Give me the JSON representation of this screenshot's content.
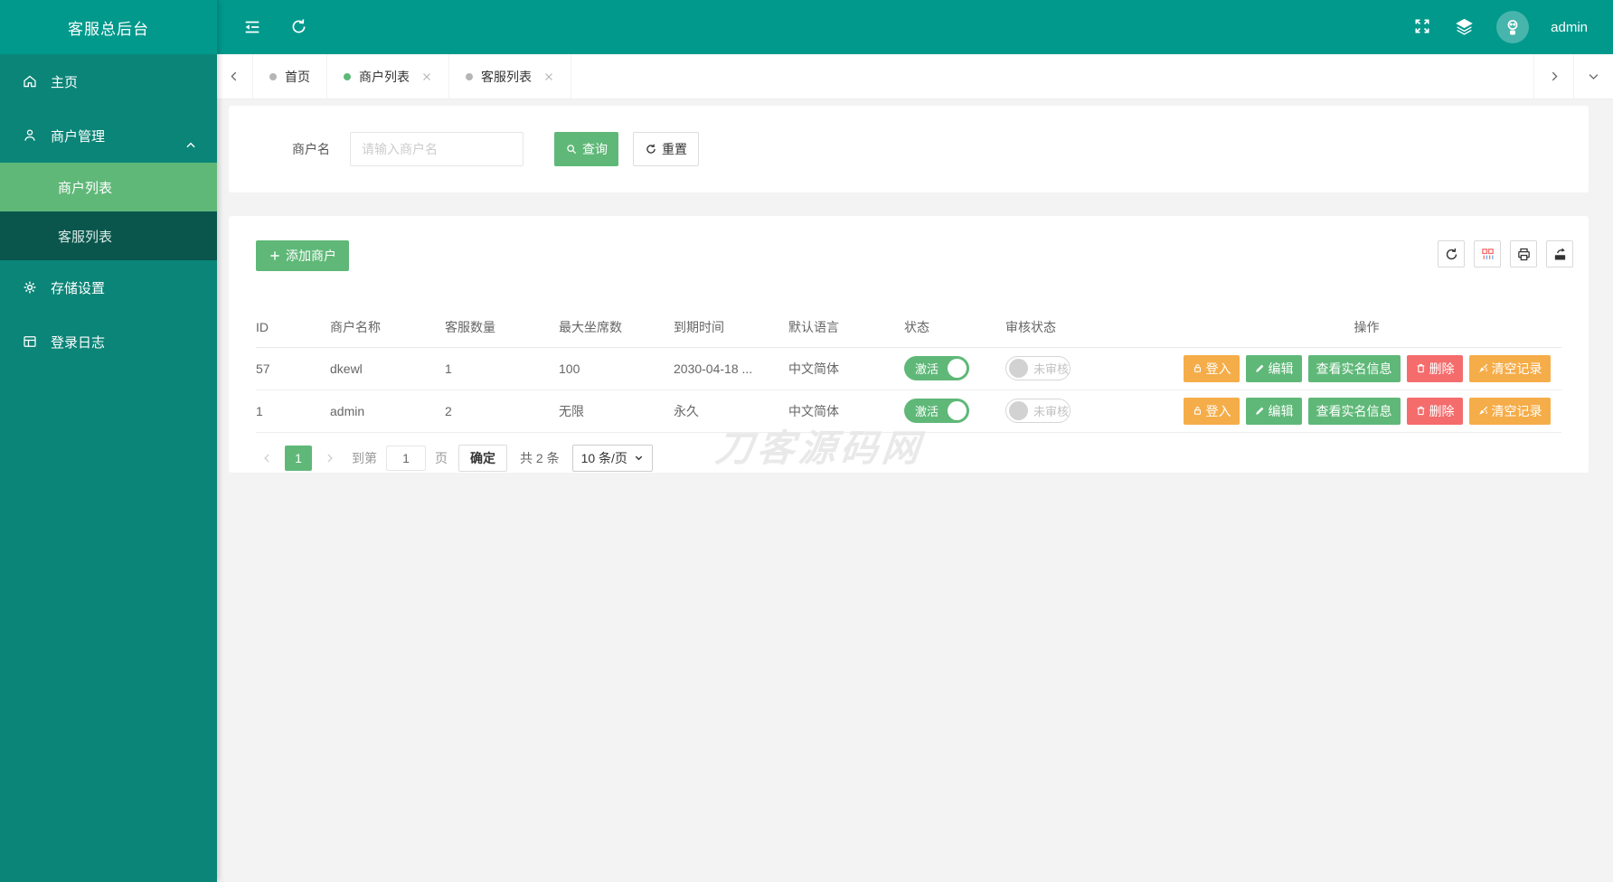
{
  "colors": {
    "teal_header": "#00998C",
    "teal_sidebar": "#0B8578",
    "accent_green": "#5FB878",
    "orange": "#F5AD49",
    "red": "#F56C6C",
    "submenu_dark": "#0A564D"
  },
  "header": {
    "username": "admin"
  },
  "sidebar": {
    "title": "客服总后台",
    "home": "主页",
    "merchant_mgmt": "商户管理",
    "merchant_list": "商户列表",
    "service_list": "客服列表",
    "storage": "存储设置",
    "login_log": "登录日志"
  },
  "tabs": {
    "home": "首页",
    "merchant_list": "商户列表",
    "service_list": "客服列表"
  },
  "search": {
    "label": "商户名",
    "placeholder": "请输入商户名",
    "query": "查询",
    "reset": "重置"
  },
  "toolbar": {
    "add": "添加商户"
  },
  "table": {
    "headers": [
      "ID",
      "商户名称",
      "客服数量",
      "最大坐席数",
      "到期时间",
      "默认语言",
      "状态",
      "审核状态",
      "操作"
    ],
    "rows": [
      {
        "id": "57",
        "name": "dkewl",
        "agents": "1",
        "seats": "100",
        "expire": "2030-04-18 ...",
        "lang": "中文简体",
        "status": "激活",
        "audit": "未审核"
      },
      {
        "id": "1",
        "name": "admin",
        "agents": "2",
        "seats": "无限",
        "expire": "永久",
        "lang": "中文简体",
        "status": "激活",
        "audit": "未审核"
      }
    ],
    "actions": {
      "login": "登入",
      "edit": "编辑",
      "realname": "查看实名信息",
      "delete": "删除",
      "clear": "清空记录"
    }
  },
  "pagination": {
    "current": "1",
    "goto": "到第",
    "page_value": "1",
    "page_unit": "页",
    "confirm": "确定",
    "total": "共 2 条",
    "page_size": "10 条/页"
  },
  "watermark": "刀客源码网",
  "icons": {
    "collapse-sidebar-icon": "lines-with-left-arrow",
    "refresh-icon": "circular-arrow",
    "fullscreen-icon": "corner-arrows",
    "layers-icon": "stacked-layers",
    "avatar": "robot-face",
    "home-icon": "house",
    "merchant-icon": "person",
    "gear-icon": "gear",
    "log-icon": "window",
    "chevron-up-icon": "chevron-up",
    "search-icon": "magnifier",
    "plus-icon": "plus",
    "columns-icon": "column-filter-grid",
    "print-icon": "printer",
    "export-icon": "export-box",
    "lock-icon": "padlock",
    "edit-icon": "pencil",
    "delete-icon": "trash",
    "clear-icon": "broom",
    "caret-down-icon": "caret-down"
  }
}
